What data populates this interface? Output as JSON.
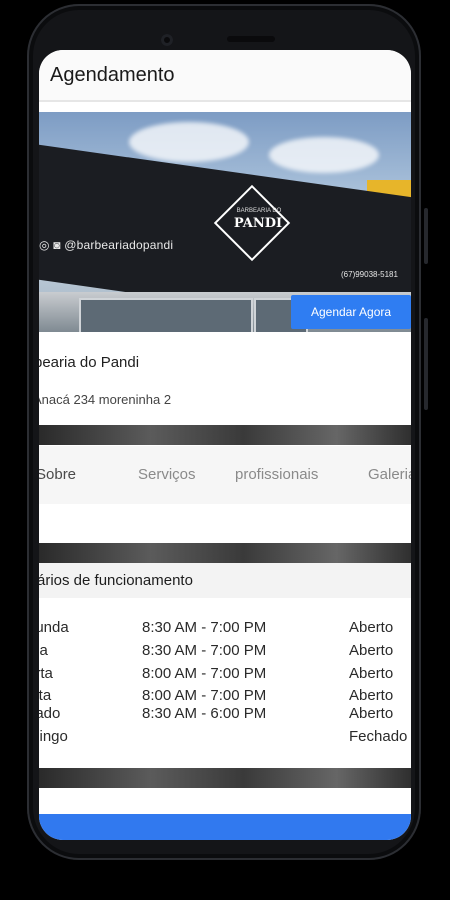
{
  "appbar": {
    "title": "Agendamento"
  },
  "banner": {
    "handle": "@barbeariadopandi",
    "logo_top": "BARBEARIA DO",
    "logo_text": "PANDI",
    "phone": "(67)99038-5181"
  },
  "agendar_button": {
    "label": "Agendar Agora"
  },
  "shop": {
    "name": "rbearia do Pandi",
    "address": "Anacá 234 moreninha 2"
  },
  "tabs": [
    {
      "label": "Sobre"
    },
    {
      "label": "Serviços"
    },
    {
      "label": "profissionais"
    },
    {
      "label": "Galeria"
    }
  ],
  "hours": {
    "title": "rários de funcionamento",
    "rows": [
      {
        "day": "gunda",
        "time": "8:30 AM - 7:00 PM",
        "status": "Aberto"
      },
      {
        "day": "rça",
        "time": "8:30 AM - 7:00 PM",
        "status": "Aberto"
      },
      {
        "day": "arta",
        "time": "8:00 AM - 7:00 PM",
        "status": "Aberto"
      },
      {
        "day": "inta",
        "time": "8:00 AM - 7:00 PM",
        "status": "Aberto"
      },
      {
        "day": "bado",
        "time": "8:30 AM - 6:00 PM",
        "status": "Aberto"
      },
      {
        "day": "mingo",
        "time": "",
        "status": "Fechado"
      }
    ]
  },
  "colors": {
    "accent": "#2f7df2",
    "bottom_bar": "#3179ef"
  }
}
